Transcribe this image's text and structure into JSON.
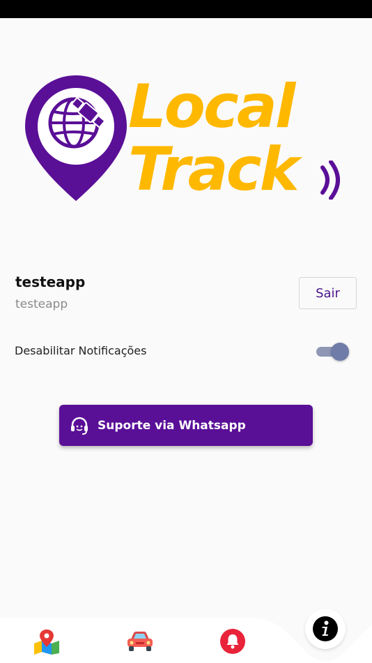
{
  "brand": {
    "name_line1": "Local",
    "name_line2": "Track",
    "colors": {
      "purple": "#5a0f97",
      "yellow": "#ffb800"
    },
    "icon": "location-pin-globe-satellite-icon"
  },
  "user": {
    "name": "testeapp",
    "username": "testeapp"
  },
  "actions": {
    "logout_label": "Sair"
  },
  "settings": {
    "disable_notifications_label": "Desabilitar Notificações",
    "disable_notifications_on": true
  },
  "support": {
    "label": "Suporte via Whatsapp",
    "icon": "headset-icon"
  },
  "bottom_nav": {
    "items": [
      {
        "id": "map",
        "icon": "map-pin-icon"
      },
      {
        "id": "vehicles",
        "icon": "car-icon"
      },
      {
        "id": "alerts",
        "icon": "bell-icon"
      },
      {
        "id": "info",
        "icon": "info-icon",
        "active": true
      }
    ]
  }
}
